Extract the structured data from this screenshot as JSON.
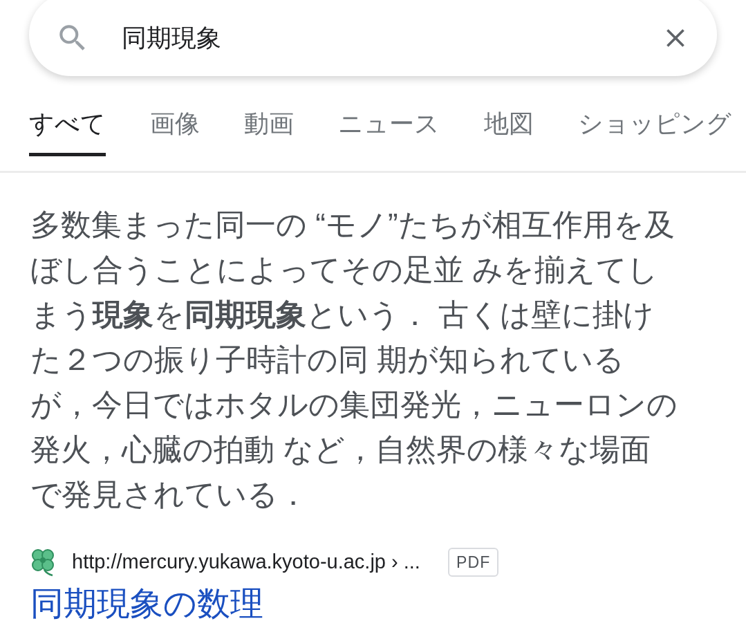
{
  "search": {
    "value": "同期現象"
  },
  "tabs": [
    {
      "label": "すべて",
      "selected": true
    },
    {
      "label": "画像",
      "selected": false
    },
    {
      "label": "動画",
      "selected": false
    },
    {
      "label": "ニュース",
      "selected": false
    },
    {
      "label": "地図",
      "selected": false
    },
    {
      "label": "ショッピング",
      "selected": false
    }
  ],
  "snippet_lines": [
    "多数集まった同一の “モノ”たちが相互作用を及",
    "ぼし合うことによってその足並 みを揃えてし",
    "まう**現象**を**同期現象**という．  古くは壁に掛け",
    "た２つの振り子時計の同 期が知られている",
    "が，今日ではホタルの集団発光，ニューロンの",
    "発火，心臓の拍動 など，自然界の様々な場面",
    "で発見されている．"
  ],
  "result": {
    "url": "http://mercury.yukawa.kyoto-u.ac.jp › ...",
    "badge": "PDF",
    "title": "同期現象の数理"
  }
}
